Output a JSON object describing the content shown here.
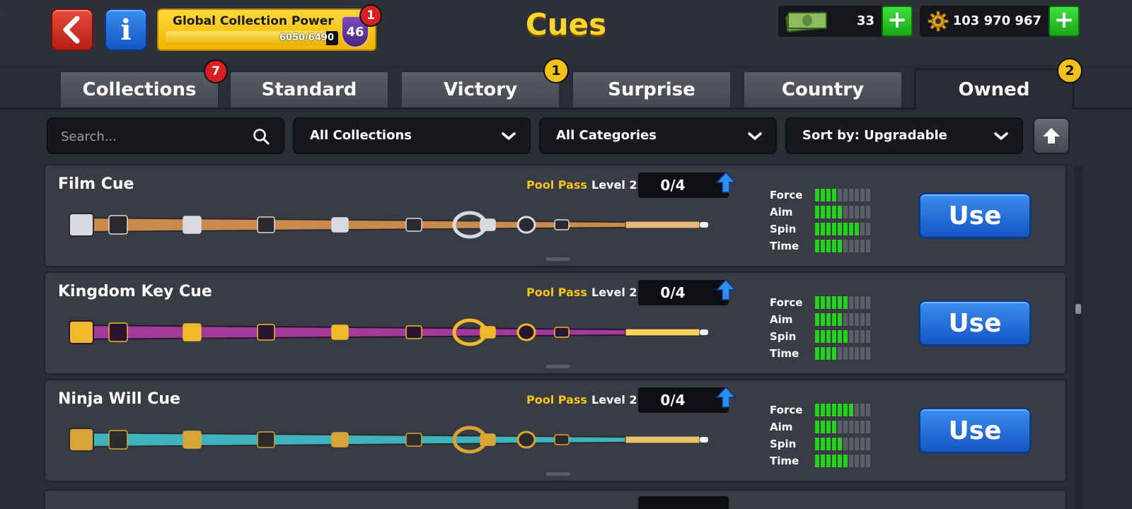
{
  "header": {
    "title": "Cues",
    "back_icon": "chevron-left-icon",
    "info_label": "i",
    "collection_power": {
      "label": "Global Collection Power",
      "progress_text": "6050/6490",
      "progress_fraction": 0.932,
      "level": "46",
      "notification": "1"
    },
    "cash": {
      "icon": "cash-icon",
      "value": "33",
      "add_label": "+"
    },
    "coins": {
      "icon": "gear-icon",
      "value": "103 970 967",
      "add_label": "+"
    }
  },
  "tabs": [
    {
      "label": "Collections",
      "badge": "7",
      "badge_color": "#d92020",
      "active": false
    },
    {
      "label": "Standard",
      "badge": "",
      "active": false
    },
    {
      "label": "Victory",
      "badge": "1",
      "badge_color": "#f2c11b",
      "active": false
    },
    {
      "label": "Surprise",
      "badge": "",
      "active": false
    },
    {
      "label": "Country",
      "badge": "",
      "active": false
    },
    {
      "label": "Owned",
      "badge": "2",
      "badge_color": "#f2c11b",
      "active": true
    }
  ],
  "filters": {
    "search_placeholder": "Search...",
    "collections": "All Collections",
    "categories": "All Categories",
    "sort": "Sort by: Upgradable"
  },
  "stat_labels": [
    "Force",
    "Aim",
    "Spin",
    "Time"
  ],
  "cues": [
    {
      "name": "Film Cue",
      "pass": "Pool Pass",
      "level": "Level 2",
      "progress": "0/4",
      "stats": [
        4,
        5,
        8,
        5
      ],
      "use_label": "Use",
      "palette": {
        "shaft": "#c98a4e",
        "accent": "#d9dadf",
        "dark": "#2a2a2e",
        "tip": "#e8b87a"
      }
    },
    {
      "name": "Kingdom Key Cue",
      "pass": "Pool Pass",
      "level": "Level 2",
      "progress": "0/4",
      "stats": [
        6,
        5,
        6,
        4
      ],
      "use_label": "Use",
      "palette": {
        "shaft": "#a23a9a",
        "accent": "#f0b92a",
        "dark": "#2a1530",
        "tip": "#f5d45a"
      }
    },
    {
      "name": "Ninja Will Cue",
      "pass": "Pool Pass",
      "level": "Level 2",
      "progress": "0/4",
      "stats": [
        7,
        4,
        5,
        6
      ],
      "use_label": "Use",
      "palette": {
        "shaft": "#3fb3bd",
        "accent": "#d9a437",
        "dark": "#2b2b2e",
        "tip": "#e9c06a"
      }
    }
  ],
  "colors": {
    "background": "#2b2d36",
    "title_gold": "#ffd52e",
    "pass_gold": "#f5c518",
    "stat_on": "#23d21f",
    "use_blue": "#1f6fe0",
    "plus_green": "#22b822"
  }
}
